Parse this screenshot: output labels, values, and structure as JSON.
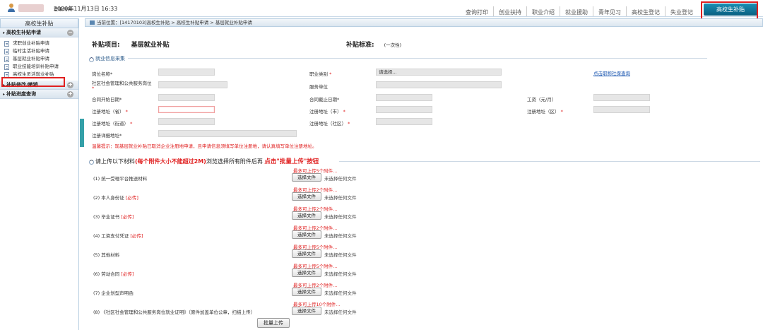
{
  "topbar": {
    "login_label": "登录时间:",
    "login_time": "2020年11月13日 16:33",
    "nav": [
      "查询打印",
      "创业扶持",
      "职业介绍",
      "就业援助",
      "青年见习",
      "高校生登记",
      "失业登记"
    ],
    "active_nav": "高校生补贴"
  },
  "sidebar": {
    "title": "高校生补贴",
    "groups": [
      {
        "label": "高校生补贴申请",
        "toggle": "−",
        "items": [
          "求职创业补贴申请",
          "临时生活补贴申请",
          "基层就业补贴申请",
          "职业技能培训补贴申请",
          "高校生灵活就业补贴"
        ]
      },
      {
        "label": "补贴修改/撤销",
        "toggle": "+"
      },
      {
        "label": "补贴进度查询",
        "toggle": "+"
      }
    ],
    "selected_item": "基层就业补贴申请"
  },
  "breadcrumb": "当前位置：[14170103]高校生补贴 > 高校生补贴申请 > 基层就业补贴申请",
  "subsidy": {
    "project_label": "补贴项目:",
    "project_value": "基层就业补贴",
    "standard_label": "补贴标准:",
    "standard_value": "(一次性)"
  },
  "section_info": {
    "title": "就业信息采集"
  },
  "form": {
    "position_name": "岗位名称*",
    "job_category": "职业类别",
    "job_category_value": "请选择...",
    "query_link": "点击职称社保查询",
    "community_post": "社区社会管理和公共服务岗位",
    "service_unit": "服务单位",
    "contract_start": "合同开始日期*",
    "contract_end": "合同截止日期*",
    "salary": "工资（元/月）",
    "reg_province": "注册地址（省）",
    "reg_city": "注册地址（市）",
    "reg_district": "注册地址（区）",
    "reg_street": "注册地址（街道）",
    "reg_community": "注册地址（社区）",
    "reg_detail": "注册详细地址*",
    "hint": "温馨提示：现基层就业补贴已取消企业注册地申请，且申请信息须填写单位注册地，请认真填写单位注册地址。"
  },
  "upload": {
    "title_prefix": "请上传以下材料",
    "title_note": "(每个附件大小不能超过2M)",
    "title_mid": "浏览选择所有附件后再",
    "title_click": "点击\"批量上传\"按钮",
    "items": [
      {
        "label": "(1) 统一受理平台推送材料",
        "required": "",
        "limit": "最多可上传5个附件..."
      },
      {
        "label": "(2) 本人身份证",
        "required": "[必传]",
        "limit": "最多可上传2个附件..."
      },
      {
        "label": "(3) 毕业证书",
        "required": "[必传]",
        "limit": "最多可上传2个附件..."
      },
      {
        "label": "(4) 工资支付凭证",
        "required": "[必传]",
        "limit": "最多可上传2个附件..."
      },
      {
        "label": "(5) 其他材料",
        "required": "",
        "limit": "最多可上传5个附件..."
      },
      {
        "label": "(6) 劳动合同",
        "required": "[必传]",
        "limit": "最多可上传5个附件..."
      },
      {
        "label": "(7) 企业划型声明函",
        "required": "",
        "limit": "最多可上传2个附件..."
      },
      {
        "label": "(8) 《社区社会管理和公共服务岗位就业证明》（原件加盖单位公章，扫描上传）",
        "required": "",
        "limit": "最多可上传10个附件..."
      }
    ],
    "file_button": "选择文件",
    "file_status": "未选择任何文件",
    "batch_button": "批量上传"
  },
  "colors": {
    "accent": "#0a5f80",
    "highlight": "#e02020",
    "link": "#1a56b0"
  }
}
